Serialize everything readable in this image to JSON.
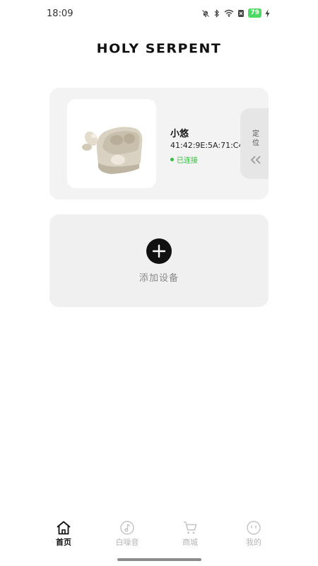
{
  "status_bar": {
    "time": "18:09",
    "battery_level": "79",
    "icons": [
      "mute-bell-icon",
      "bluetooth-icon",
      "wifi-icon",
      "sim-icon",
      "battery-icon",
      "charging-icon"
    ]
  },
  "brand": {
    "title": "HOLY SERPENT"
  },
  "device_card": {
    "name": "小悠",
    "mac": "41:42:9E:5A:71:C4",
    "status": "已连接",
    "status_color": "#2fbf3a",
    "locate_label": "定位",
    "image_icon": "earbuds-case-image"
  },
  "add_device": {
    "label": "添加设备",
    "icon": "plus-icon"
  },
  "bottom_nav": {
    "items": [
      {
        "label": "首页",
        "icon": "home-icon",
        "active": true
      },
      {
        "label": "白噪音",
        "icon": "music-note-icon",
        "active": false
      },
      {
        "label": "商城",
        "icon": "cart-icon",
        "active": false
      },
      {
        "label": "我的",
        "icon": "profile-face-icon",
        "active": false
      }
    ]
  }
}
